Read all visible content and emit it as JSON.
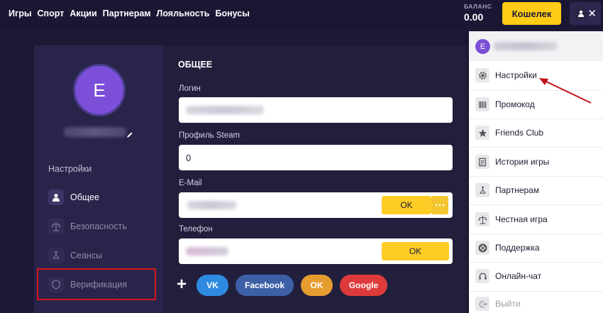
{
  "nav": {
    "items": [
      "Игры",
      "Спорт",
      "Акции",
      "Партнерам",
      "Лояльность",
      "Бонусы"
    ]
  },
  "header": {
    "balance_label": "БАЛАНС",
    "balance_value": "0.00",
    "wallet_label": "Кошелек"
  },
  "profile": {
    "avatar_letter": "E"
  },
  "sidebar": {
    "title": "Настройки",
    "items": [
      {
        "label": "Общее",
        "icon": "user-icon",
        "active": true
      },
      {
        "label": "Безопасность",
        "icon": "scales-icon",
        "active": false
      },
      {
        "label": "Сеансы",
        "icon": "network-icon",
        "active": false
      },
      {
        "label": "Верификация",
        "icon": "shield-icon",
        "active": false
      }
    ]
  },
  "general": {
    "title": "ОБЩЕЕ",
    "login_label": "Логин",
    "steam_label": "Профиль Steam",
    "steam_value": "0",
    "email_label": "E-Mail",
    "email_ok": "OK",
    "phone_label": "Телефон",
    "phone_ok": "OK"
  },
  "social": {
    "vk": "VK",
    "facebook": "Facebook",
    "ok": "OK",
    "google": "Google"
  },
  "dropdown": {
    "avatar_letter": "E",
    "items": [
      {
        "label": "Настройки",
        "icon": "gear-icon"
      },
      {
        "label": "Промокод",
        "icon": "barcode-icon"
      },
      {
        "label": "Friends Club",
        "icon": "star-icon"
      },
      {
        "label": "История игры",
        "icon": "history-icon"
      },
      {
        "label": "Партнерам",
        "icon": "network-icon"
      },
      {
        "label": "Честная игра",
        "icon": "scales-icon"
      },
      {
        "label": "Поддержка",
        "icon": "lifebuoy-icon"
      },
      {
        "label": "Онлайн-чат",
        "icon": "headset-icon"
      },
      {
        "label": "Выйти",
        "icon": "logout-icon"
      }
    ]
  },
  "colors": {
    "accent": "#ffcc15",
    "background": "#1c1937",
    "avatar": "#7b4fd8",
    "highlight": "#d8151c"
  }
}
